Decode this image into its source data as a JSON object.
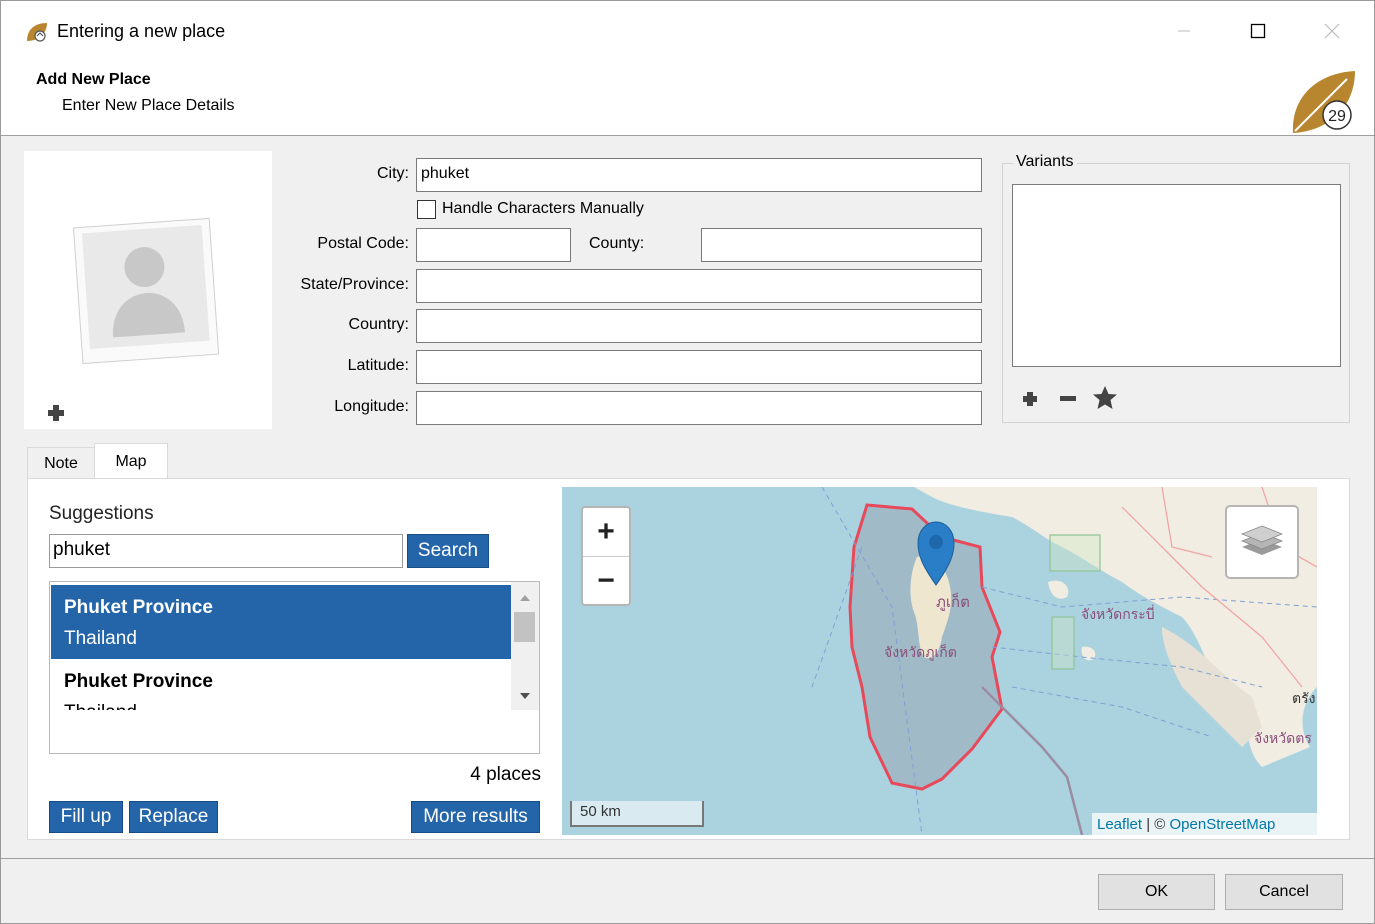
{
  "window": {
    "title": "Entering a new place",
    "header_title": "Add New Place",
    "header_subtitle": "Enter New Place Details",
    "logo_text": "29"
  },
  "form": {
    "city_label": "City:",
    "city_value": "phuket",
    "handle_chars_label": "Handle Characters Manually",
    "handle_chars_checked": false,
    "postal_label": "Postal Code:",
    "postal_value": "",
    "county_label": "County:",
    "county_value": "",
    "state_label": "State/Province:",
    "state_value": "",
    "country_label": "Country:",
    "country_value": "",
    "latitude_label": "Latitude:",
    "latitude_value": "",
    "longitude_label": "Longitude:",
    "longitude_value": ""
  },
  "variants": {
    "title": "Variants"
  },
  "tabs": [
    {
      "label": "Note",
      "active": false
    },
    {
      "label": "Map",
      "active": true
    }
  ],
  "suggestions": {
    "title": "Suggestions",
    "query": "phuket",
    "search_label": "Search",
    "results": [
      {
        "name": "Phuket Province",
        "country": "Thailand",
        "selected": true
      },
      {
        "name": "Phuket Province",
        "country": "Thailand",
        "selected": false
      }
    ],
    "count_text": "4 places",
    "fill_up_label": "Fill up",
    "replace_label": "Replace",
    "more_results_label": "More results"
  },
  "map": {
    "zoom_in": "+",
    "zoom_out": "−",
    "scale_label": "50 km",
    "attribution_leaflet": "Leaflet",
    "attribution_sep": " | © ",
    "attribution_osm": "OpenStreetMap",
    "labels": {
      "phuket_town": "ภูเก็ต",
      "phuket_province": "จังหวัดภูเก็ต",
      "krabi_province": "จังหวัดกระบี่",
      "trang": "ตรัง",
      "trang_province": "จังหวัดตร"
    }
  },
  "footer": {
    "ok_label": "OK",
    "cancel_label": "Cancel"
  },
  "colors": {
    "accent_blue": "#2465a9",
    "sea": "#aad3df",
    "province_border": "#e8495a"
  }
}
